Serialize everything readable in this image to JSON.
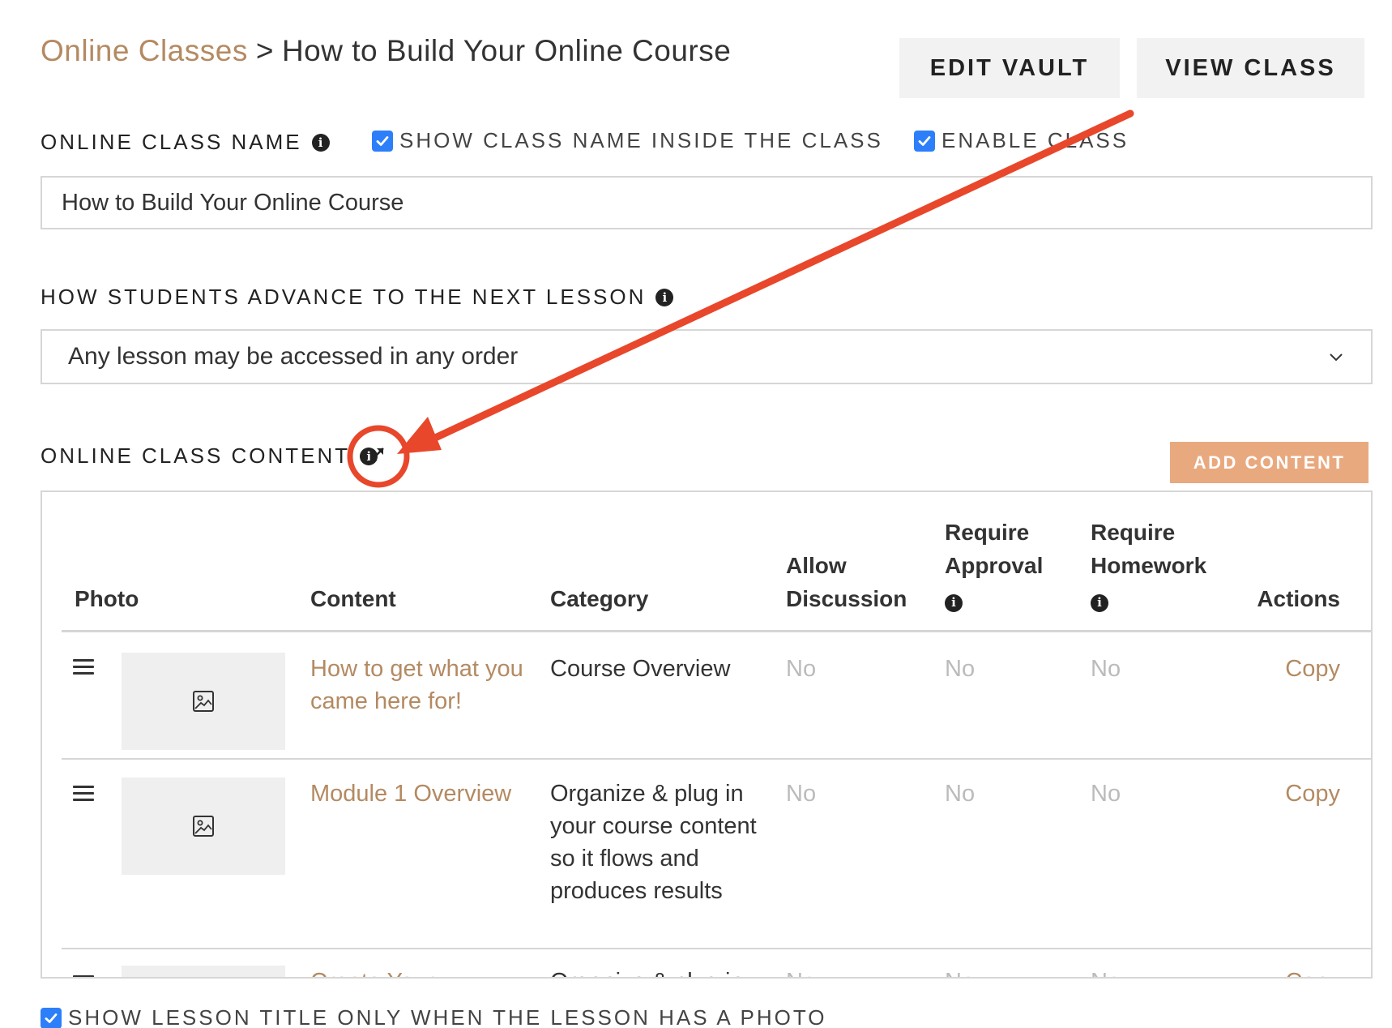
{
  "breadcrumb": {
    "parent": "Online Classes",
    "separator": ">",
    "current": "How to Build Your Online Course"
  },
  "buttons": {
    "edit_vault": "EDIT VAULT",
    "view_class": "VIEW CLASS",
    "add_content": "ADD CONTENT"
  },
  "class_name": {
    "label": "ONLINE CLASS NAME",
    "value": "How to Build Your Online Course",
    "show_name_label": "SHOW CLASS NAME INSIDE THE CLASS",
    "show_name_checked": true,
    "enable_label": "ENABLE CLASS",
    "enable_checked": true
  },
  "advance": {
    "label": "HOW STUDENTS ADVANCE TO THE NEXT LESSON",
    "selected": "Any lesson may be accessed in any order"
  },
  "content": {
    "label": "ONLINE CLASS CONTENT",
    "columns": {
      "photo": "Photo",
      "content": "Content",
      "category": "Category",
      "allow_discussion": "Allow Discussion",
      "require_approval": "Require Approval",
      "require_homework": "Require Homework",
      "actions": "Actions"
    },
    "rows": [
      {
        "content": "How to get what you came here for!",
        "category": "Course Overview",
        "allow_discussion": "No",
        "require_approval": "No",
        "require_homework": "No",
        "action": "Copy"
      },
      {
        "content": "Module 1 Overview",
        "category": "Organize & plug in your course content so it flows and produces results",
        "allow_discussion": "No",
        "require_approval": "No",
        "require_homework": "No",
        "action": "Copy"
      },
      {
        "content": "Create Your",
        "category": "Organize & plug in",
        "allow_discussion": "No",
        "require_approval": "No",
        "require_homework": "No",
        "action": "Copy"
      }
    ]
  },
  "lesson_title_option": {
    "label": "SHOW LESSON TITLE ONLY WHEN THE LESSON HAS A PHOTO",
    "checked": true
  },
  "colors": {
    "accent_link": "#b48a62",
    "add_button": "#e9a97f",
    "checkbox": "#2d7ff9",
    "annotation": "#e8472b"
  },
  "icons": [
    "info-icon",
    "expand-icon",
    "drag-handle-icon",
    "image-placeholder-icon",
    "chevron-down-icon",
    "checkmark-icon"
  ]
}
